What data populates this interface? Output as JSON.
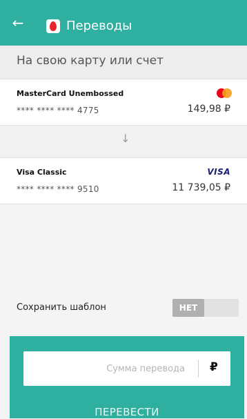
{
  "header": {
    "title": "Переводы",
    "back_icon": "arrow-left-icon",
    "logo_icon": "mts-bank-logo",
    "accent_color": "#2eaf9f"
  },
  "subheader": {
    "text": "На свою карту или счет"
  },
  "source_card": {
    "name": "MasterCard Unembossed",
    "number": "**** **** **** 4775",
    "balance": "149,98 ₽",
    "brand_icon": "mastercard-logo-icon"
  },
  "transfer_arrow": {
    "glyph": "↓",
    "icon": "arrow-down-icon"
  },
  "target_card": {
    "name": "Visa Classic",
    "number": "**** **** **** 9510",
    "balance": "11 739,05 ₽",
    "brand_label": "VISA"
  },
  "save_template": {
    "label": "Сохранить шаблон",
    "toggle_value": "НЕТ"
  },
  "amount": {
    "placeholder": "Сумма перевода",
    "currency": "₽",
    "value": ""
  },
  "submit": {
    "label": "ПЕРЕВЕСТИ"
  }
}
